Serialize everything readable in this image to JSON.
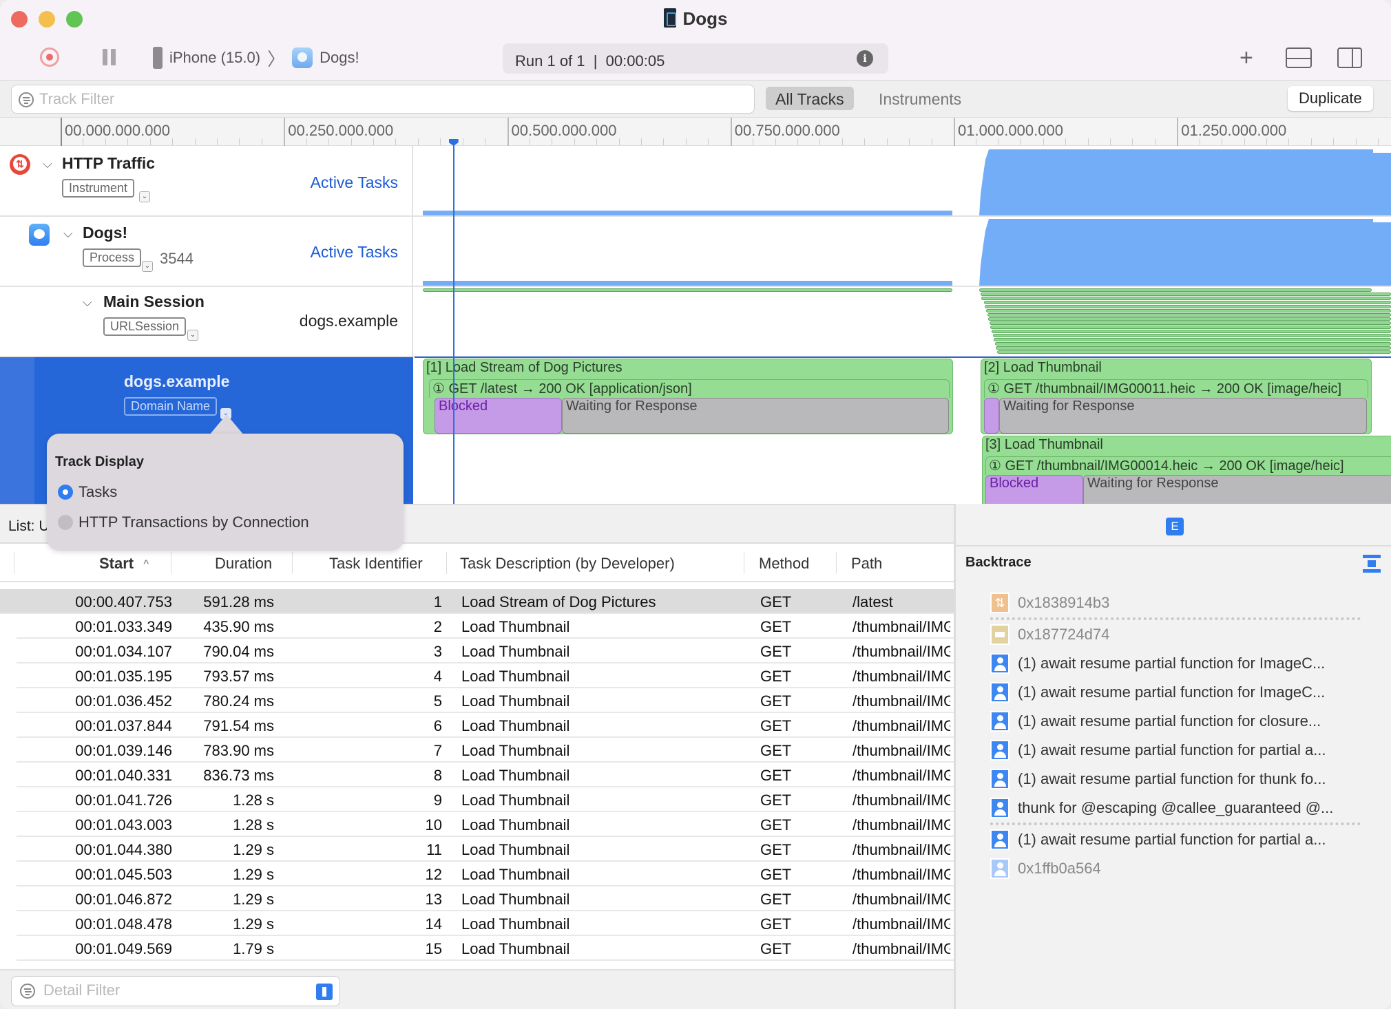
{
  "window": {
    "title": "Dogs"
  },
  "toolbar": {
    "record_label": "Record",
    "pause_label": "Pause",
    "device": "iPhone (15.0)",
    "target_app": "Dogs!",
    "run_status": "Run 1 of 1  |  00:00:05",
    "info_label": "i"
  },
  "filterbar": {
    "track_filter_placeholder": "Track Filter",
    "scopes": [
      "All Tracks",
      "Instruments"
    ],
    "selected_scope": "All Tracks",
    "duplicate_label": "Duplicate"
  },
  "ruler": {
    "labels": [
      "00.000.000.000",
      "00.250.000.000",
      "00.500.000.000",
      "00.750.000.000",
      "01.000.000.000",
      "01.250.000.000"
    ],
    "cursor_time_s": 0.44
  },
  "tracks": [
    {
      "name": "HTTP Traffic",
      "badge": "Instrument",
      "right_label": "Active Tasks",
      "icon": "http-traffic-instrument-icon"
    },
    {
      "name": "Dogs!",
      "badge": "Process",
      "pid": "3544",
      "right_label": "Active Tasks",
      "icon": "dogs-app-icon"
    },
    {
      "name": "Main Session",
      "badge": "URLSession",
      "right_label": "dogs.example"
    },
    {
      "name": "dogs.example",
      "badge": "Domain Name",
      "selected": true
    }
  ],
  "timeline_tasks": [
    {
      "title": "[1] Load Stream of Dog Pictures",
      "transaction": "① GET /latest → 200 OK [application/json]",
      "phases": [
        "Blocked",
        "Waiting for Response"
      ]
    },
    {
      "title": "[2] Load Thumbnail",
      "transaction": "① GET /thumbnail/IMG00011.heic → 200 OK [image/heic]",
      "phases": [
        "",
        "Waiting for Response"
      ]
    },
    {
      "title": "[3] Load Thumbnail",
      "transaction": "① GET /thumbnail/IMG00014.heic → 200 OK [image/heic]",
      "phases": [
        "Blocked",
        "Waiting for Response"
      ]
    }
  ],
  "popover": {
    "title": "Track Display",
    "options": [
      "Tasks",
      "HTTP Transactions by Connection"
    ],
    "selected": "Tasks"
  },
  "list": {
    "label": "List: U"
  },
  "table": {
    "columns": [
      "Start",
      "Duration",
      "Task Identifier",
      "Task Description (by Developer)",
      "Method",
      "Path"
    ],
    "sort_column": "Start",
    "rows": [
      {
        "start": "00:00.407.753",
        "duration": "591.28 ms",
        "id": "1",
        "desc": "Load Stream of Dog Pictures",
        "method": "GET",
        "path": "/latest",
        "selected": true
      },
      {
        "start": "00:01.033.349",
        "duration": "435.90 ms",
        "id": "2",
        "desc": "Load Thumbnail",
        "method": "GET",
        "path": "/thumbnail/IMG"
      },
      {
        "start": "00:01.034.107",
        "duration": "790.04 ms",
        "id": "3",
        "desc": "Load Thumbnail",
        "method": "GET",
        "path": "/thumbnail/IMG"
      },
      {
        "start": "00:01.035.195",
        "duration": "793.57 ms",
        "id": "4",
        "desc": "Load Thumbnail",
        "method": "GET",
        "path": "/thumbnail/IMG"
      },
      {
        "start": "00:01.036.452",
        "duration": "780.24 ms",
        "id": "5",
        "desc": "Load Thumbnail",
        "method": "GET",
        "path": "/thumbnail/IMG"
      },
      {
        "start": "00:01.037.844",
        "duration": "791.54 ms",
        "id": "6",
        "desc": "Load Thumbnail",
        "method": "GET",
        "path": "/thumbnail/IMG"
      },
      {
        "start": "00:01.039.146",
        "duration": "783.90 ms",
        "id": "7",
        "desc": "Load Thumbnail",
        "method": "GET",
        "path": "/thumbnail/IMG"
      },
      {
        "start": "00:01.040.331",
        "duration": "836.73 ms",
        "id": "8",
        "desc": "Load Thumbnail",
        "method": "GET",
        "path": "/thumbnail/IMG"
      },
      {
        "start": "00:01.041.726",
        "duration": "1.28 s",
        "id": "9",
        "desc": "Load Thumbnail",
        "method": "GET",
        "path": "/thumbnail/IMG"
      },
      {
        "start": "00:01.043.003",
        "duration": "1.28 s",
        "id": "10",
        "desc": "Load Thumbnail",
        "method": "GET",
        "path": "/thumbnail/IMG"
      },
      {
        "start": "00:01.044.380",
        "duration": "1.29 s",
        "id": "11",
        "desc": "Load Thumbnail",
        "method": "GET",
        "path": "/thumbnail/IMG"
      },
      {
        "start": "00:01.045.503",
        "duration": "1.29 s",
        "id": "12",
        "desc": "Load Thumbnail",
        "method": "GET",
        "path": "/thumbnail/IMG"
      },
      {
        "start": "00:01.046.872",
        "duration": "1.29 s",
        "id": "13",
        "desc": "Load Thumbnail",
        "method": "GET",
        "path": "/thumbnail/IMG"
      },
      {
        "start": "00:01.048.478",
        "duration": "1.29 s",
        "id": "14",
        "desc": "Load Thumbnail",
        "method": "GET",
        "path": "/thumbnail/IMG"
      },
      {
        "start": "00:01.049.569",
        "duration": "1.79 s",
        "id": "15",
        "desc": "Load Thumbnail",
        "method": "GET",
        "path": "/thumbnail/IMG"
      }
    ]
  },
  "detail_filter": {
    "placeholder": "Detail Filter"
  },
  "detail": {
    "extended_button": "E",
    "backtrace_title": "Backtrace",
    "frames": [
      {
        "icon": "network-icon",
        "text": "0x1838914b3",
        "dim": true,
        "separator_after": true
      },
      {
        "icon": "library-icon",
        "text": "0x187724d74",
        "dim": true
      },
      {
        "icon": "user-frame-icon",
        "text": "(1) await resume partial function for ImageC..."
      },
      {
        "icon": "user-frame-icon",
        "text": "(1) await resume partial function for ImageC..."
      },
      {
        "icon": "user-frame-icon",
        "text": "(1) await resume partial function for closure..."
      },
      {
        "icon": "user-frame-icon",
        "text": "(1) await resume partial function for partial a..."
      },
      {
        "icon": "user-frame-icon",
        "text": "(1) await resume partial function for thunk fo..."
      },
      {
        "icon": "user-frame-icon",
        "text": "thunk for @escaping @callee_guaranteed @...",
        "separator_after": true
      },
      {
        "icon": "user-frame-icon",
        "text": "(1) await resume partial function for partial a..."
      },
      {
        "icon": "user-frame-icon-faded",
        "text": "0x1ffb0a564",
        "dim": true
      }
    ]
  }
}
